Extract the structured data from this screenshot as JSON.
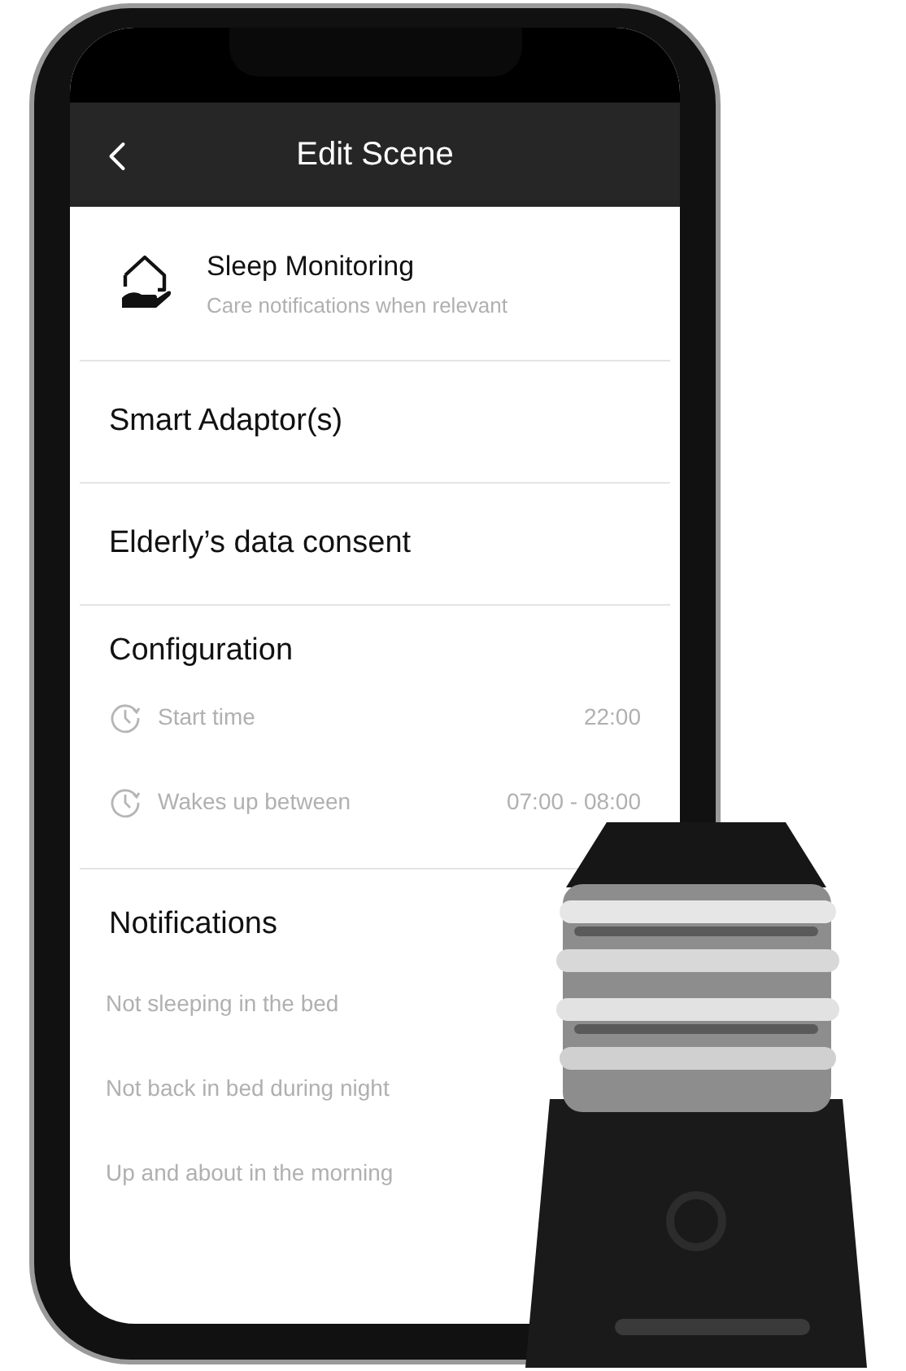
{
  "title": "Edit Scene",
  "scene": {
    "name": "Sleep Monitoring",
    "description": "Care notifications when relevant"
  },
  "menu_items": [
    "Smart Adaptor(s)",
    "Elderly’s data consent"
  ],
  "configuration": {
    "heading": "Configuration",
    "rows": [
      {
        "label": "Start time",
        "value": "22:00"
      },
      {
        "label": "Wakes up between",
        "value": "07:00 - 08:00"
      }
    ]
  },
  "notifications": {
    "heading": "Notifications",
    "items": [
      "Not sleeping in the bed",
      "Not back in bed during night",
      "Up and about in the morning"
    ]
  }
}
